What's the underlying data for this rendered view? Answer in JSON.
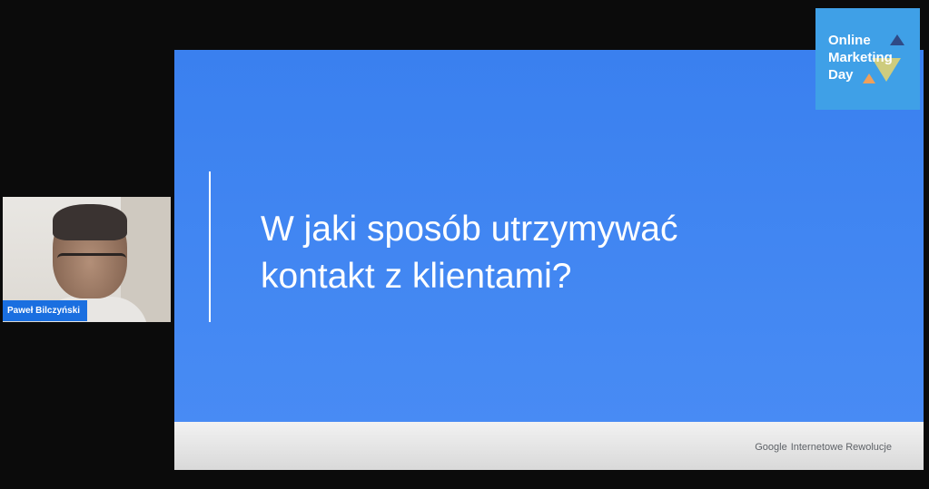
{
  "slide": {
    "title_line1": "W jaki sposób utrzymywać",
    "title_line2": "kontakt z klientami?",
    "footer_brand": "Google",
    "footer_sub": "Internetowe Rewolucje"
  },
  "presenter": {
    "name": "Paweł Bilczyński"
  },
  "event_logo": {
    "line1": "Online",
    "line2": "Marketing",
    "line3": "Day"
  },
  "colors": {
    "slide_blue": "#3a80ef",
    "name_tag_blue": "#1a6fe0",
    "logo_blue": "#3fa0e7",
    "background": "#0b0b0b"
  }
}
